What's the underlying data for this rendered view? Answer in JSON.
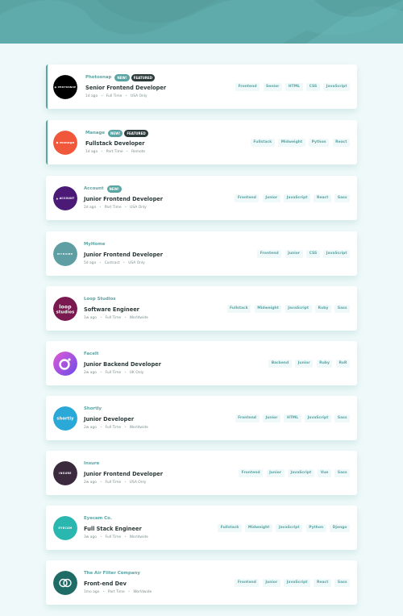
{
  "colors": {
    "primary": "#5ba4a4",
    "dark": "#2c3a3a",
    "background": "#eff9f9",
    "tag_background": "#eff9f9"
  },
  "header": {
    "background_image": "bg-header-waves"
  },
  "jobs": [
    {
      "company": "Photosnap",
      "logo_text": "PHOTOSNAP",
      "logo_icon": "photosnap-logo-icon",
      "logo_color": "#000000",
      "new_label": "NEW!",
      "featured_label": "FEATURED",
      "position": "Senior Frontend Developer",
      "posted": "1d ago",
      "contract": "Full Time",
      "location": "USA Only",
      "tags": [
        "Frontend",
        "Senior",
        "HTML",
        "CSS",
        "JavaScript"
      ]
    },
    {
      "company": "Manage",
      "logo_text": "manage",
      "logo_icon": "manage-logo-icon",
      "logo_color": "#f1573b",
      "new_label": "NEW!",
      "featured_label": "FEATURED",
      "position": "Fullstack Developer",
      "posted": "1d ago",
      "contract": "Part Time",
      "location": "Remote",
      "tags": [
        "Fullstack",
        "Midweight",
        "Python",
        "React"
      ]
    },
    {
      "company": "Account",
      "logo_text": "ACCOUNT",
      "logo_icon": "account-logo-icon",
      "logo_color": "#4a1a76",
      "new_label": "NEW!",
      "featured_label": "",
      "position": "Junior Frontend Developer",
      "posted": "2d ago",
      "contract": "Part Time",
      "location": "USA Only",
      "tags": [
        "Frontend",
        "Junior",
        "JavaScript",
        "React",
        "Sass"
      ]
    },
    {
      "company": "MyHome",
      "logo_text": "MYHOME",
      "logo_icon": "myhome-logo-icon",
      "logo_color": "#5f9fa3",
      "new_label": "",
      "featured_label": "",
      "position": "Junior Frontend Developer",
      "posted": "5d ago",
      "contract": "Contract",
      "location": "USA Only",
      "tags": [
        "Frontend",
        "Junior",
        "CSS",
        "JavaScript"
      ]
    },
    {
      "company": "Loop Studios",
      "logo_text": "loop studios",
      "logo_icon": "loop-studios-logo-icon",
      "logo_color": "#7a1850",
      "new_label": "",
      "featured_label": "",
      "position": "Software Engineer",
      "posted": "1w ago",
      "contract": "Full Time",
      "location": "Worldwide",
      "tags": [
        "Fullstack",
        "Midweight",
        "JavaScript",
        "Ruby",
        "Sass"
      ]
    },
    {
      "company": "FaceIt",
      "logo_text": "",
      "logo_icon": "faceit-logo-icon",
      "logo_color": "#9a5be8",
      "new_label": "",
      "featured_label": "",
      "position": "Junior Backend Developer",
      "posted": "2w ago",
      "contract": "Full Time",
      "location": "UK Only",
      "tags": [
        "Backend",
        "Junior",
        "Ruby",
        "RoR"
      ]
    },
    {
      "company": "Shortly",
      "logo_text": "shortly",
      "logo_icon": "shortly-logo-icon",
      "logo_color": "#2aa8d8",
      "new_label": "",
      "featured_label": "",
      "position": "Junior Developer",
      "posted": "2w ago",
      "contract": "Full Time",
      "location": "Worldwide",
      "tags": [
        "Frontend",
        "Junior",
        "HTML",
        "JavaScript",
        "Sass"
      ]
    },
    {
      "company": "Insure",
      "logo_text": "INSURE",
      "logo_icon": "insure-logo-icon",
      "logo_color": "#3b2a3e",
      "new_label": "",
      "featured_label": "",
      "position": "Junior Frontend Developer",
      "posted": "2w ago",
      "contract": "Full Time",
      "location": "USA Only",
      "tags": [
        "Frontend",
        "Junior",
        "JavaScript",
        "Vue",
        "Sass"
      ]
    },
    {
      "company": "Eyecam Co.",
      "logo_text": "EYECAM",
      "logo_icon": "eyecam-logo-icon",
      "logo_color": "#2ab7b0",
      "new_label": "",
      "featured_label": "",
      "position": "Full Stack Engineer",
      "posted": "3w ago",
      "contract": "Full Time",
      "location": "Worldwide",
      "tags": [
        "Fullstack",
        "Midweight",
        "JavaScript",
        "Python",
        "Django"
      ]
    },
    {
      "company": "The Air Filter Company",
      "logo_text": "",
      "logo_icon": "air-filter-logo-icon",
      "logo_color": "#1f6b66",
      "new_label": "",
      "featured_label": "",
      "position": "Front-end Dev",
      "posted": "1mo ago",
      "contract": "Part Time",
      "location": "Worldwide",
      "tags": [
        "Frontend",
        "Junior",
        "JavaScript",
        "React",
        "Sass"
      ]
    }
  ]
}
